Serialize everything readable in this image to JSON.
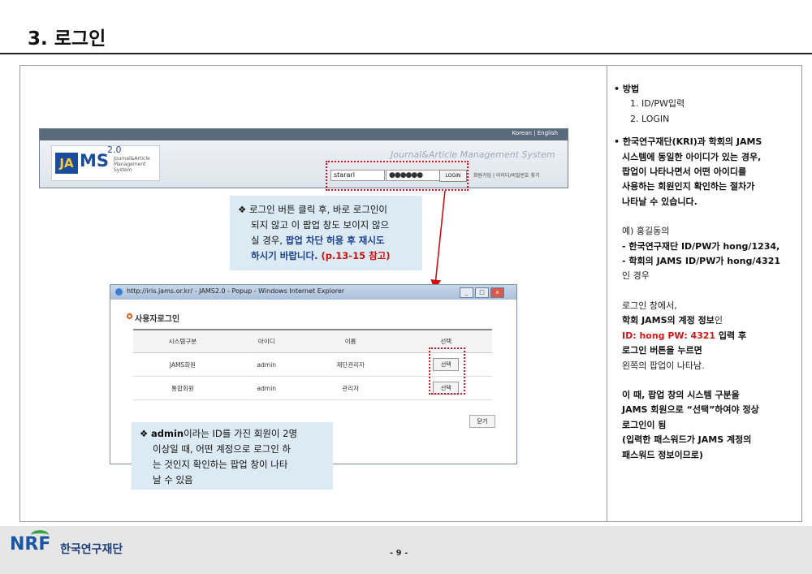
{
  "header": {
    "title": "3. 로그인"
  },
  "jams_screenshot": {
    "top_links": "Korean  |  English",
    "logo_ja": "JA",
    "logo_ms": "MS",
    "logo_version": "2.0",
    "logo_sub": "Journal&Article Management System",
    "tagline": "Journal&Article  Management System",
    "id_value": "stararl",
    "pw_value": "●●●●●●",
    "login_button": "LOGIN",
    "links": "회원가입 | 아이디/비밀번호 찾기"
  },
  "callout_1": {
    "line1": "❖ 로그인 버튼 클릭 후, 바로 로그인이",
    "line2": "되지 않고 이 팝업 창도 보이지 않으",
    "line3_plain": "실 경우, ",
    "line3_bold": "팝업 차단 허용 후 재시도",
    "line4_bold": "하시기 바랍니다. ",
    "line4_red": "(p.13-15 참고)"
  },
  "popup": {
    "window_title": "http://iris.jams.or.kr/ - JAMS2.0 - Popup - Windows Internet Explorer",
    "heading": "사용자로그인",
    "columns": [
      "시스템구분",
      "아이디",
      "이름",
      "선택"
    ],
    "rows": [
      {
        "system": "JAMS회원",
        "id": "admin",
        "name": "재단관리자",
        "action": "선택"
      },
      {
        "system": "통합회원",
        "id": "admin",
        "name": "관리자",
        "action": "선택"
      }
    ],
    "close_button": "닫기"
  },
  "callout_2": {
    "line1_bold": "admin",
    "line1_rest": "이라는 ID를 가진 회원이 2명",
    "line2": "이상일 때, 어떤 계정으로 로그인 하",
    "line3": "는 것인지 확인하는 팝업 창이 나타",
    "line4": "날 수 있음"
  },
  "right_panel": {
    "method_title": "• 방법",
    "method_1": "1.  ID/PW입력",
    "method_2": "2. LOGIN",
    "p1_l1": "• 한국연구재단(KRI)과 학회의 JAMS",
    "p1_l2": "시스템에 동일한 아이디가 있는 경우,",
    "p1_l3": "팝업이 나타나면서 어떤 아이디를",
    "p1_l4": "사용하는 회원인지 확인하는 절차가",
    "p1_l5": "나타날 수 있습니다.",
    "ex_l1": "예) 홍길동의",
    "ex_l2": "- 한국연구재단  ID/PW가 hong/1234,",
    "ex_l3": "- 학회의 JAMS ID/PW가 hong/4321",
    "ex_l4": "인 경우",
    "lg_l1": "로그인 창에서,",
    "lg_l2_bold": "학회 JAMS의 계정 정보",
    "lg_l2_plain": "인",
    "lg_l3_red": "ID: hong PW: 4321",
    "lg_l3_bold": " 입력 후",
    "lg_l4": "로그인 버튼을 누르면",
    "lg_l5": "왼쪽의 팝업이 나타남.",
    "end_l1": "이 때, 팝업 창의 시스템 구분을",
    "end_l2": "JAMS 회원으로 “선택”하여야 정상",
    "end_l3": "로그인이 됨",
    "end_l4": "(입력한 패스워드가 JAMS 계정의",
    "end_l5": "패스워드 정보이므로)"
  },
  "footer": {
    "logo_text": "NRF",
    "org_name": "한국연구재단",
    "page_number": "- 9 -"
  },
  "colors": {
    "accent_red": "#cc1111",
    "callout_bg": "#dcebf3",
    "blue_text": "#1f3f8a"
  }
}
